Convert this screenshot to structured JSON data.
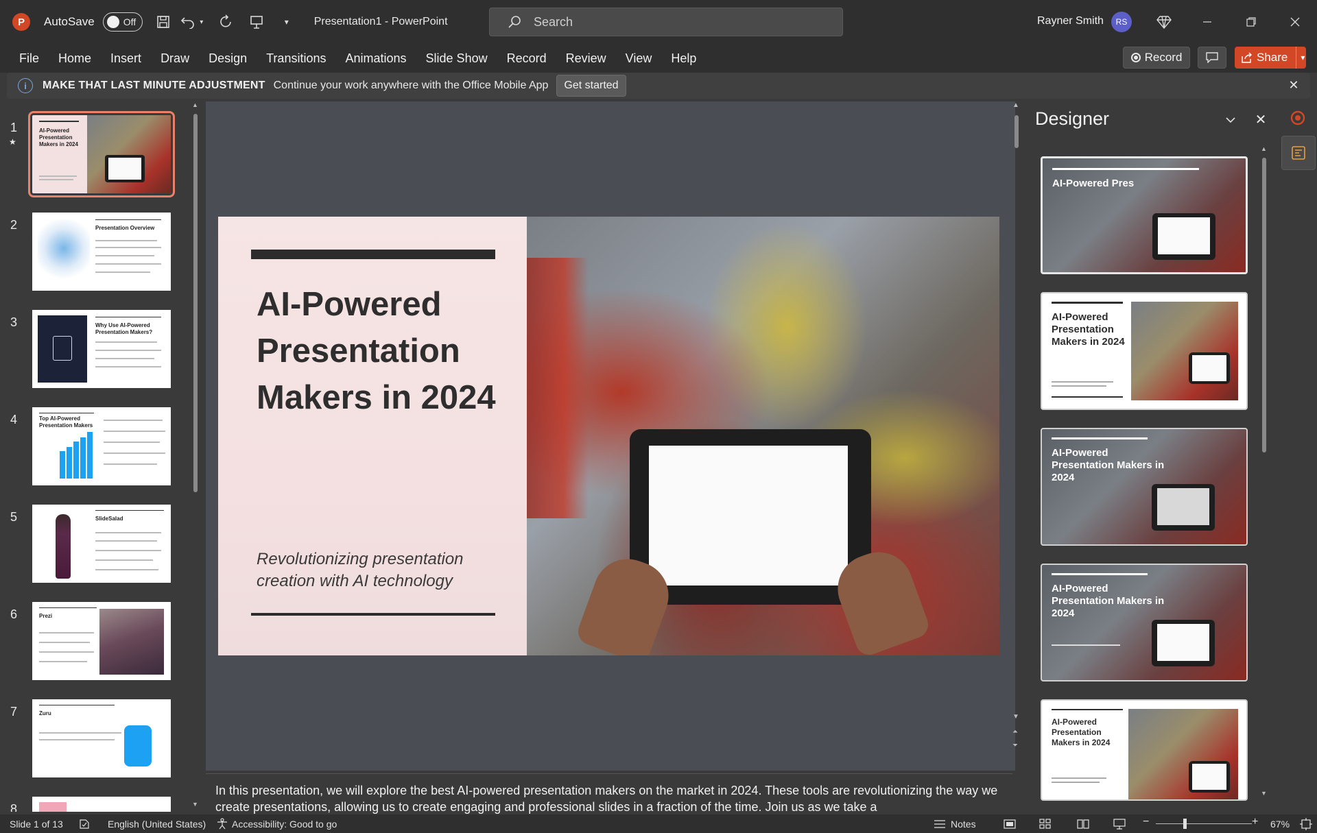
{
  "window": {
    "autosave_label": "AutoSave",
    "autosave_state": "Off",
    "doc_title": "Presentation1  -  PowerPoint",
    "search_placeholder": "Search",
    "user_name": "Rayner Smith",
    "user_initials": "RS"
  },
  "menu": [
    "File",
    "Home",
    "Insert",
    "Draw",
    "Design",
    "Transitions",
    "Animations",
    "Slide Show",
    "Record",
    "Review",
    "View",
    "Help"
  ],
  "actions": {
    "record_label": "Record",
    "share_label": "Share"
  },
  "infobar": {
    "title": "MAKE THAT LAST MINUTE ADJUSTMENT",
    "message": "Continue your work anywhere with the Office Mobile App",
    "button": "Get started"
  },
  "thumbnails": [
    {
      "num": "1",
      "title": "AI-Powered Presentation Makers in 2024"
    },
    {
      "num": "2",
      "title": "Presentation Overview"
    },
    {
      "num": "3",
      "title": "Why Use AI-Powered Presentation Makers?"
    },
    {
      "num": "4",
      "title": "Top AI-Powered Presentation Makers"
    },
    {
      "num": "5",
      "title": "SlideSalad"
    },
    {
      "num": "6",
      "title": "Prezi"
    },
    {
      "num": "7",
      "title": "Zuru"
    },
    {
      "num": "8",
      "title": ""
    }
  ],
  "slide": {
    "title": "AI-Powered Presentation Makers in 2024",
    "subtitle": "Revolutionizing presentation creation with AI technology"
  },
  "notes": "In this presentation, we will explore the best AI-powered presentation makers on the market in 2024. These tools are revolutionizing the way we create presentations, allowing us to create engaging and professional slides in a fraction of the time. Join us as we take a",
  "designer": {
    "title": "Designer",
    "cards": [
      {
        "title": "AI-Powered Pres"
      },
      {
        "title": "AI-Powered Presentation Makers in 2024"
      },
      {
        "title": "AI-Powered Presentation Makers in 2024"
      },
      {
        "title": "AI-Powered Presentation Makers in 2024"
      },
      {
        "title": "AI-Powered Presentation Makers in 2024"
      }
    ]
  },
  "status": {
    "slide_info": "Slide 1 of 13",
    "language": "English (United States)",
    "accessibility": "Accessibility: Good to go",
    "notes_label": "Notes",
    "zoom": "67%"
  },
  "colors": {
    "accent": "#d24726",
    "selection": "#e8826b",
    "avatar": "#5b5fc7"
  }
}
